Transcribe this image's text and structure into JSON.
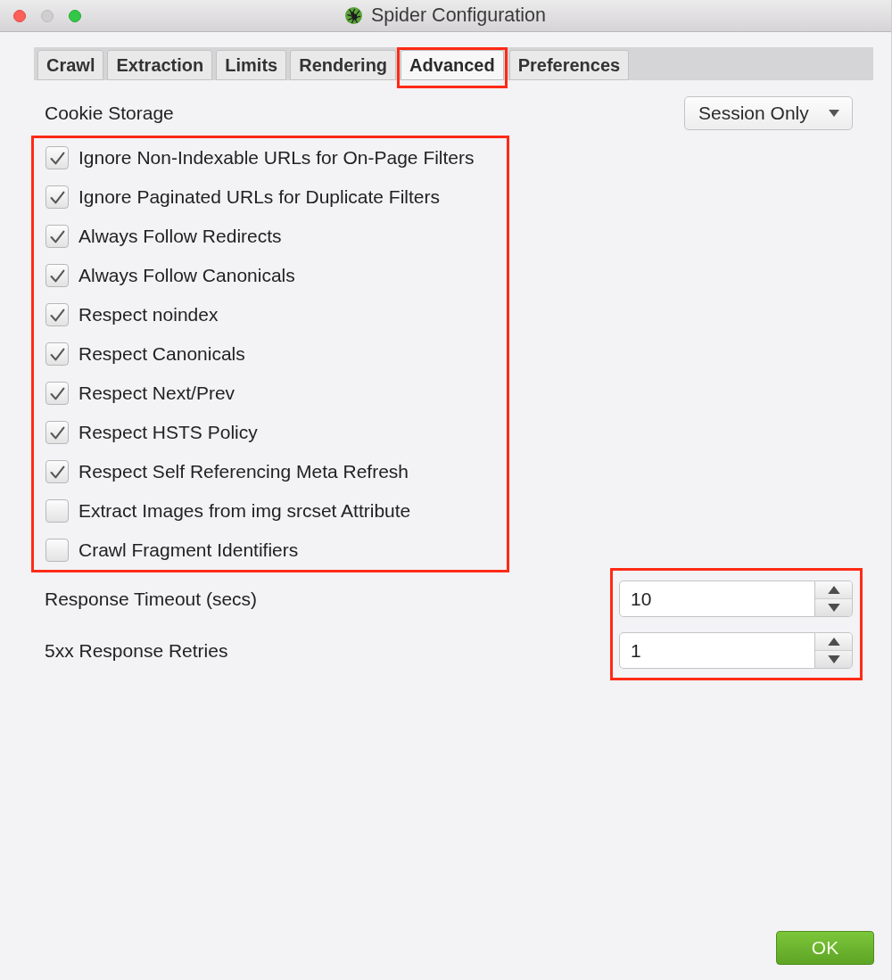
{
  "window": {
    "title": "Spider Configuration"
  },
  "tabs": [
    {
      "label": "Crawl",
      "selected": false,
      "highlighted": false
    },
    {
      "label": "Extraction",
      "selected": false,
      "highlighted": false
    },
    {
      "label": "Limits",
      "selected": false,
      "highlighted": false
    },
    {
      "label": "Rendering",
      "selected": false,
      "highlighted": false
    },
    {
      "label": "Advanced",
      "selected": true,
      "highlighted": true
    },
    {
      "label": "Preferences",
      "selected": false,
      "highlighted": false
    }
  ],
  "cookie_storage": {
    "label": "Cookie Storage",
    "value": "Session Only"
  },
  "options": {
    "highlighted": true,
    "items": [
      {
        "label": "Ignore Non-Indexable URLs for On-Page Filters",
        "checked": true
      },
      {
        "label": "Ignore Paginated URLs for Duplicate Filters",
        "checked": true
      },
      {
        "label": "Always Follow Redirects",
        "checked": true
      },
      {
        "label": "Always Follow Canonicals",
        "checked": true
      },
      {
        "label": "Respect noindex",
        "checked": true
      },
      {
        "label": "Respect Canonicals",
        "checked": true
      },
      {
        "label": "Respect Next/Prev",
        "checked": true
      },
      {
        "label": "Respect HSTS Policy",
        "checked": true
      },
      {
        "label": "Respect Self Referencing Meta Refresh",
        "checked": true
      },
      {
        "label": "Extract Images from img srcset Attribute",
        "checked": false
      },
      {
        "label": "Crawl Fragment Identifiers",
        "checked": false
      }
    ]
  },
  "spinners": {
    "highlighted": true,
    "items": [
      {
        "label": "Response Timeout (secs)",
        "value": "10"
      },
      {
        "label": "5xx Response Retries",
        "value": "1"
      }
    ]
  },
  "buttons": [
    {
      "label": "OK",
      "kind": "primary"
    }
  ]
}
